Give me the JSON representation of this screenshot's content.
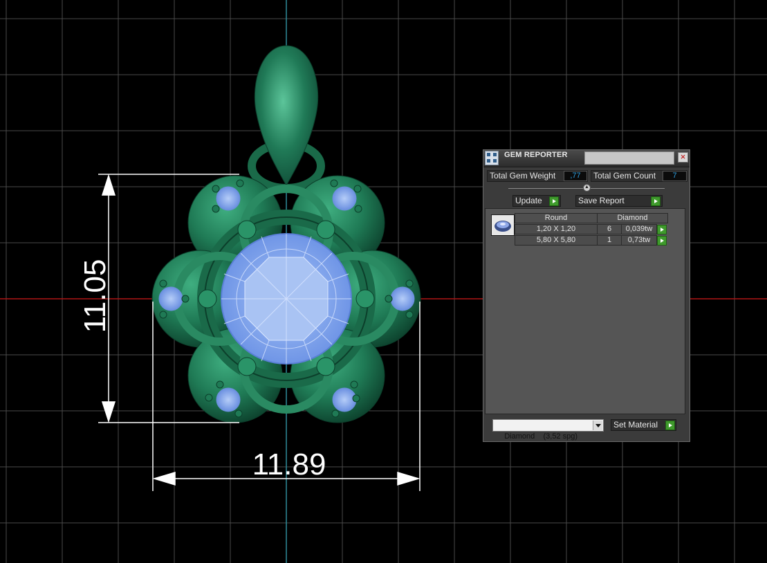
{
  "dimensions": {
    "height": "11.05",
    "width": "11.89"
  },
  "gem_reporter": {
    "title": "GEM REPORTER",
    "close_symbol": "×",
    "total_weight_label": "Total Gem Weight",
    "total_weight_value": ",77",
    "total_count_label": "Total Gem Count",
    "total_count_value": "7",
    "update_label": "Update",
    "save_report_label": "Save Report",
    "table": {
      "headers": [
        "Round",
        "Diamond"
      ],
      "rows": [
        {
          "size": "1,20 X 1,20",
          "count": "6",
          "weight": "0,039tw"
        },
        {
          "size": "5,80 X 5,80",
          "count": "1",
          "weight": "0,73tw"
        }
      ]
    },
    "material_value": "Diamond    (3,52 spg)",
    "set_material_label": "Set Material"
  },
  "colors": {
    "metal": "#1f7a55",
    "metal_light": "#3fae80",
    "metal_dark": "#0c3f2b",
    "gem": "#8fb3f2",
    "grid": "#4a4a4a",
    "axis_red": "#b01515",
    "axis_teal": "#2f8e9c",
    "accent_green": "#3f9a2c"
  }
}
